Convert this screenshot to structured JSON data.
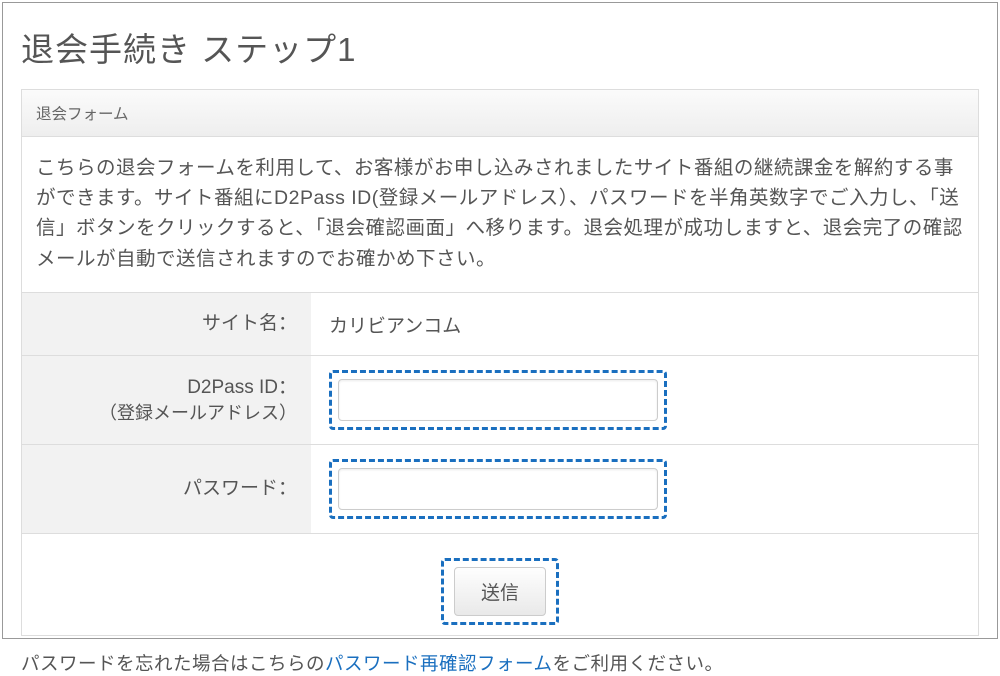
{
  "page": {
    "title": "退会手続き ステップ1"
  },
  "panel": {
    "header": "退会フォーム",
    "description": "こちらの退会フォームを利用して、お客様がお申し込みされましたサイト番組の継続課金を解約する事ができます。サイト番組にD2Pass ID(登録メールアドレス）、パスワードを半角英数字でご入力し、「送信」ボタンをクリックすると、「退会確認画面」へ移ります。退会処理が成功しますと、退会完了の確認メールが自動で送信されますのでお確かめ下さい。"
  },
  "form": {
    "site_label": "サイト名：",
    "site_value": "カリビアンコム",
    "d2pass_label": "D2Pass ID：",
    "d2pass_sublabel": "（登録メールアドレス）",
    "password_label": "パスワード：",
    "submit_label": "送信"
  },
  "forgot": {
    "prefix": "パスワードを忘れた場合はこちらの",
    "link": "パスワード再確認フォーム",
    "suffix": "をご利用ください。"
  }
}
